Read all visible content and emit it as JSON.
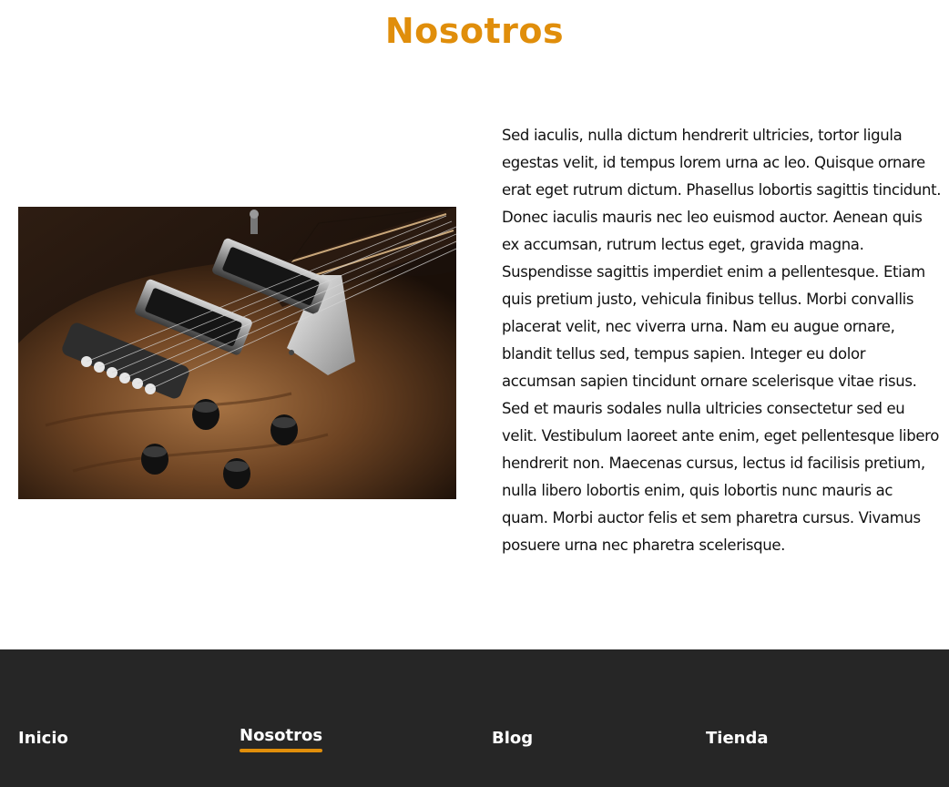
{
  "colors": {
    "accent": "#e08e0b",
    "footer_bg": "#262626",
    "text": "#111111"
  },
  "page": {
    "title": "Nosotros"
  },
  "about": {
    "image_subject": "electric-guitar-photo",
    "body": "Sed iaculis, nulla dictum hendrerit ultricies, tortor ligula egestas velit, id tempus lorem urna ac leo. Quisque ornare erat eget rutrum dictum. Phasellus lobortis sagittis tincidunt. Donec iaculis mauris nec leo euismod auctor. Aenean quis ex accumsan, rutrum lectus eget, gravida magna. Suspendisse sagittis imperdiet enim a pellentesque. Etiam quis pretium justo, vehicula finibus tellus. Morbi convallis placerat velit, nec viverra urna. Nam eu augue ornare, blandit tellus sed, tempus sapien. Integer eu dolor accumsan sapien tincidunt ornare scelerisque vitae risus. Sed et mauris sodales nulla ultricies consectetur sed eu velit. Vestibulum laoreet ante enim, eget pellentesque libero hendrerit non. Maecenas cursus, lectus id facilisis pretium, nulla libero lobortis enim, quis lobortis nunc mauris ac quam. Morbi auctor felis et sem pharetra cursus. Vivamus posuere urna nec pharetra scelerisque."
  },
  "footer": {
    "nav": [
      {
        "label": "Inicio",
        "active": false
      },
      {
        "label": "Nosotros",
        "active": true
      },
      {
        "label": "Blog",
        "active": false
      },
      {
        "label": "Tienda",
        "active": false
      }
    ]
  }
}
